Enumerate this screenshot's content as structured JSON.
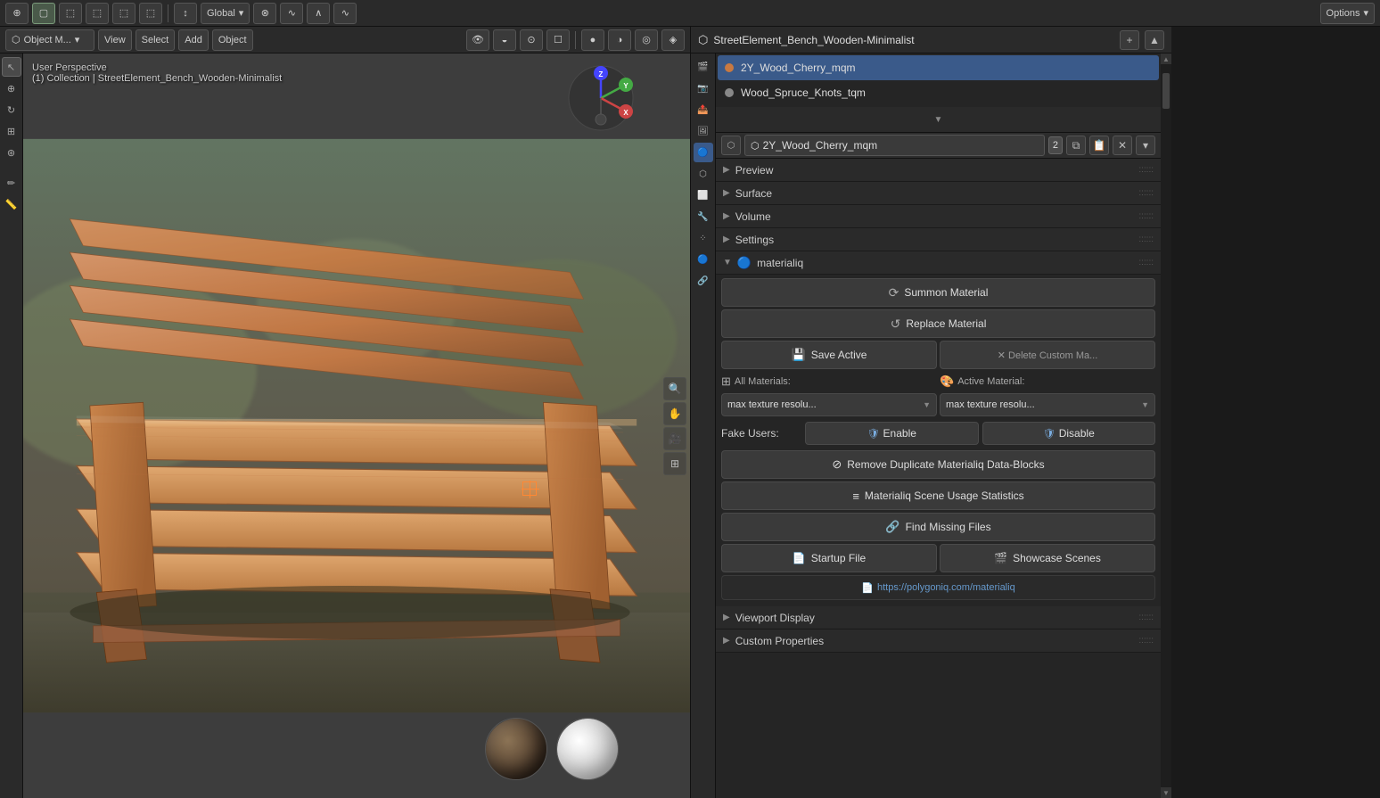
{
  "app": {
    "title": "StreetElement_Bench_Wooden-Minimalist"
  },
  "top_toolbar": {
    "mode_label": "Object M...",
    "view_label": "View",
    "select_label": "Select",
    "add_label": "Add",
    "object_label": "Object",
    "global_label": "Global",
    "options_label": "Options"
  },
  "viewport": {
    "info_line1": "User Perspective",
    "info_line2": "(1) Collection | StreetElement_Bench_Wooden-Minimalist"
  },
  "materials": {
    "active": "2Y_Wood_Cherry_mqm",
    "secondary": "Wood_Spruce_Knots_tqm",
    "user_count": "2"
  },
  "sections": {
    "preview": "Preview",
    "surface": "Surface",
    "volume": "Volume",
    "settings": "Settings",
    "materialiq": "materialiq"
  },
  "buttons": {
    "summon_material": "Summon Material",
    "replace_material": "Replace Material",
    "save_active": "Save Active",
    "delete_custom": "✕ Delete Custom Ma...",
    "all_materials_label": "All Materials:",
    "active_material_label": "Active Material:",
    "max_texture_resolu1": "max texture resolu...",
    "max_texture_resolu2": "max texture resolu...",
    "fake_users_label": "Fake Users:",
    "enable_label": "Enable",
    "disable_label": "Disable",
    "remove_duplicates": "Remove Duplicate Materialiq Data-Blocks",
    "scene_usage": "Materialiq Scene Usage Statistics",
    "find_missing": "Find Missing Files",
    "startup_file": "Startup File",
    "showcase_scenes": "Showcase Scenes",
    "info_url": "https://polygoniq.com/materialiq",
    "viewport_display": "Viewport Display",
    "custom_properties": "Custom Properties"
  }
}
